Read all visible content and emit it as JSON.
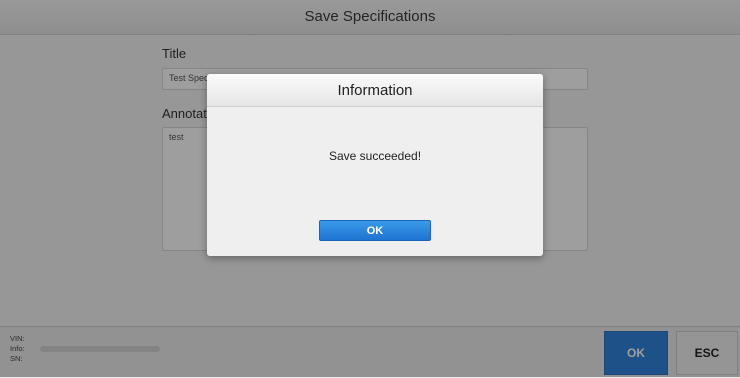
{
  "header": {
    "title": "Save Specifications"
  },
  "form": {
    "title_label": "Title",
    "title_value": "Test Specification",
    "annotation_label": "Annotation",
    "annotation_value": "test"
  },
  "footer": {
    "vin_label": "VIN:",
    "info_label": "Info:",
    "sn_label": "SN:",
    "ok_label": "OK",
    "esc_label": "ESC"
  },
  "dialog": {
    "title": "Information",
    "message": "Save succeeded!",
    "ok_label": "OK"
  },
  "colors": {
    "primary_button": "#2f84dc",
    "dialog_button": "#2a86e0"
  }
}
